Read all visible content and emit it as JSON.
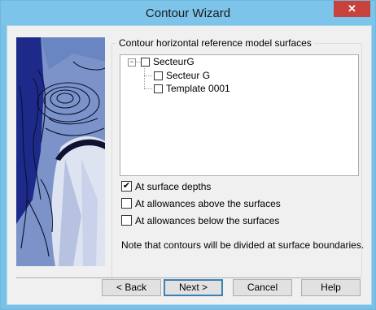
{
  "window": {
    "title": "Contour Wizard",
    "close_glyph": "✕"
  },
  "group": {
    "label": "Contour horizontal reference model surfaces"
  },
  "tree": {
    "root": {
      "label": "SecteurG",
      "expander": "−",
      "checked": false
    },
    "children": [
      {
        "label": "Secteur G",
        "checked": false
      },
      {
        "label": "Template 0001",
        "checked": false
      }
    ]
  },
  "options": [
    {
      "label": "At surface depths",
      "checked": true,
      "mark": "✔"
    },
    {
      "label": "At allowances above the surfaces",
      "checked": false,
      "mark": ""
    },
    {
      "label": "At allowances below the surfaces",
      "checked": false,
      "mark": ""
    }
  ],
  "note": "Note that contours will be divided at surface boundaries.",
  "buttons": {
    "back": "< Back",
    "next": "Next >",
    "cancel": "Cancel",
    "help": "Help"
  },
  "colors": {
    "titlebar": "#7cc4ea",
    "close": "#c7423b",
    "dialog": "#f0f0f0",
    "default_button_border": "#3c7fb1"
  }
}
